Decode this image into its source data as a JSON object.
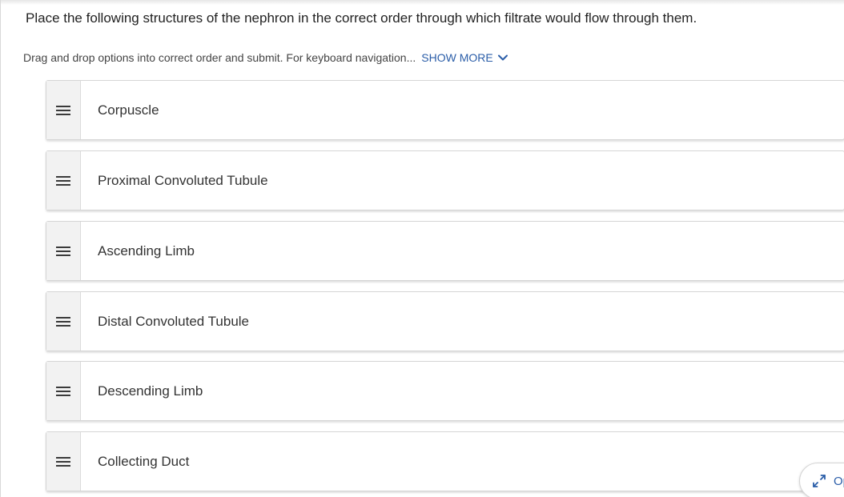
{
  "question": {
    "text": "Place the following structures of the nephron in the correct order through which filtrate would flow through them."
  },
  "instructions": {
    "text": "Drag and drop options into correct order and submit. For keyboard navigation...",
    "show_more_label": "SHOW MORE",
    "show_more_icon": "chevron-down-icon"
  },
  "items": [
    {
      "label": "Corpuscle",
      "icon": "drag-handle-icon"
    },
    {
      "label": "Proximal Convoluted Tubule",
      "icon": "drag-handle-icon"
    },
    {
      "label": "Ascending Limb",
      "icon": "drag-handle-icon"
    },
    {
      "label": "Distal Convoluted Tubule",
      "icon": "drag-handle-icon"
    },
    {
      "label": "Descending Limb",
      "icon": "drag-handle-icon"
    },
    {
      "label": "Collecting Duct",
      "icon": "drag-handle-icon"
    }
  ],
  "corner_button": {
    "label": "Op",
    "icon": "expand-arrows-icon"
  },
  "colors": {
    "link": "#2a5da8",
    "text": "#333333",
    "handle_bg": "#f2f2f2",
    "border": "#d5d5d5"
  }
}
